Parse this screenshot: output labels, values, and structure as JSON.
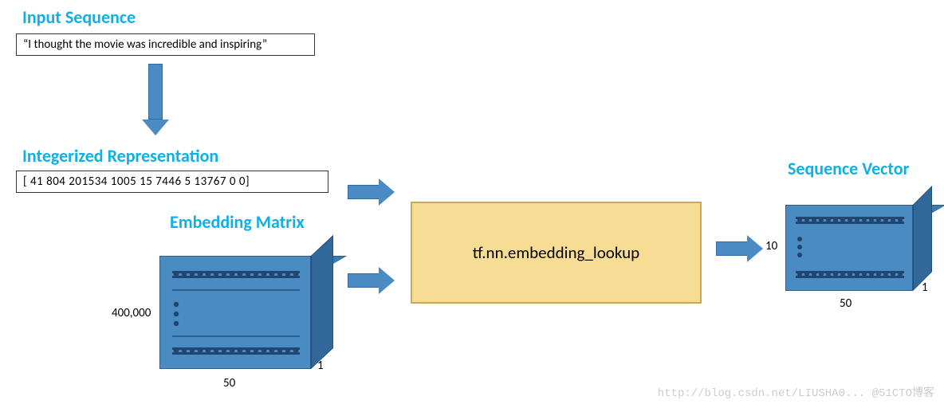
{
  "headings": {
    "input": "Input Sequence",
    "integerized": "Integerized Representation",
    "embedding": "Embedding Matrix",
    "sequence_vector": "Sequence Vector"
  },
  "input_text": "“I thought the movie was incredible and inspiring”",
  "int_sequence": "[ 41  804  201534  1005  15  7446  5  13767  0  0]",
  "lookup_fn": "tf.nn.embedding_lookup",
  "matrix_dims": {
    "rows": "400,000",
    "cols": "50",
    "depth": "1"
  },
  "seqvec_dims": {
    "rows": "10",
    "cols": "50",
    "depth": "1"
  },
  "watermark": "http://blog.csdn.net/LIUSHA0... @51CTO博客"
}
